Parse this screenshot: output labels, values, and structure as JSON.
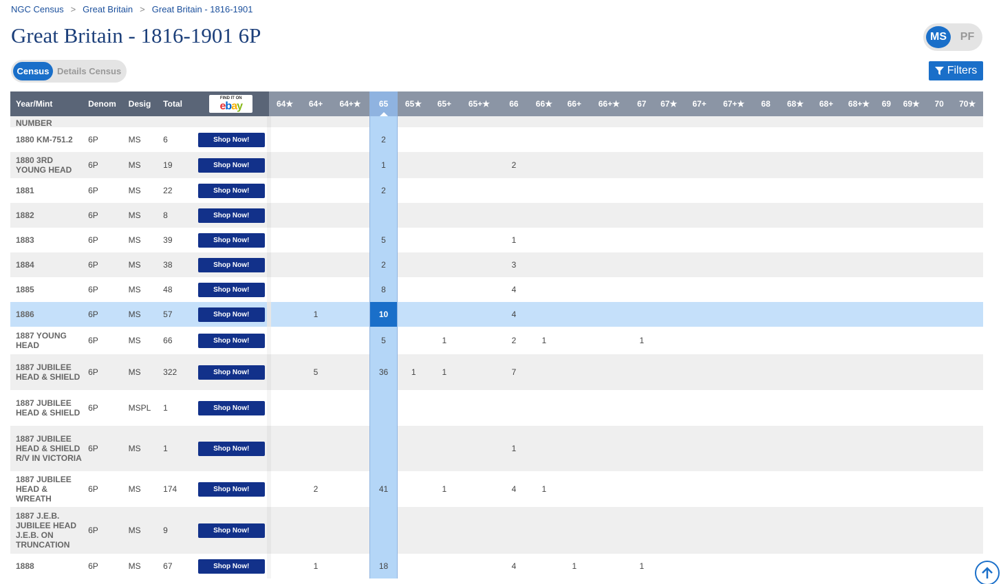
{
  "breadcrumb": [
    "NGC Census",
    "Great Britain",
    "Great Britain - 1816-1901"
  ],
  "title": "Great Britain - 1816-1901 6P",
  "grade_type": {
    "ms": "MS",
    "pf": "PF",
    "active": "MS"
  },
  "view_toggle": {
    "census": "Census",
    "details": "Details Census",
    "active": "Census"
  },
  "filters_label": "Filters",
  "ebay": {
    "find_text": "FIND IT ON",
    "logo": "ebay"
  },
  "columns": {
    "year_mint": "Year/Mint",
    "denom": "Denom",
    "desig": "Desig",
    "total": "Total",
    "grades": [
      "64★",
      "64+",
      "64+★",
      "65",
      "65★",
      "65+",
      "65+★",
      "66",
      "66★",
      "66+",
      "66+★",
      "67",
      "67★",
      "67+",
      "67+★",
      "68",
      "68★",
      "68+",
      "68+★",
      "69",
      "69★",
      "70",
      "70★"
    ]
  },
  "shop_label": "Shop Now!",
  "partial_top_row": {
    "year_mint": "NUMBER"
  },
  "rows": [
    {
      "year_mint": "1880 KM-751.2",
      "denom": "6P",
      "desig": "MS",
      "total": "6",
      "grades": {
        "65": "2"
      }
    },
    {
      "year_mint": "1880 3RD YOUNG HEAD",
      "denom": "6P",
      "desig": "MS",
      "total": "19",
      "grades": {
        "65": "1",
        "66": "2"
      }
    },
    {
      "year_mint": "1881",
      "denom": "6P",
      "desig": "MS",
      "total": "22",
      "grades": {
        "65": "2"
      }
    },
    {
      "year_mint": "1882",
      "denom": "6P",
      "desig": "MS",
      "total": "8",
      "grades": {}
    },
    {
      "year_mint": "1883",
      "denom": "6P",
      "desig": "MS",
      "total": "39",
      "grades": {
        "65": "5",
        "66": "1"
      }
    },
    {
      "year_mint": "1884",
      "denom": "6P",
      "desig": "MS",
      "total": "38",
      "grades": {
        "65": "2",
        "66": "3"
      }
    },
    {
      "year_mint": "1885",
      "denom": "6P",
      "desig": "MS",
      "total": "48",
      "grades": {
        "65": "8",
        "66": "4"
      }
    },
    {
      "year_mint": "1886",
      "denom": "6P",
      "desig": "MS",
      "total": "57",
      "grades": {
        "64+": "1",
        "65": "10",
        "66": "4"
      },
      "highlight": true
    },
    {
      "year_mint": "1887 YOUNG HEAD",
      "denom": "6P",
      "desig": "MS",
      "total": "66",
      "grades": {
        "65": "5",
        "65+": "1",
        "66": "2",
        "66★": "1",
        "67": "1"
      }
    },
    {
      "year_mint": "1887 JUBILEE HEAD & SHIELD",
      "denom": "6P",
      "desig": "MS",
      "total": "322",
      "grades": {
        "64+": "5",
        "65": "36",
        "65★": "1",
        "65+": "1",
        "66": "7"
      }
    },
    {
      "year_mint": "1887 JUBILEE HEAD & SHIELD",
      "denom": "6P",
      "desig": "MSPL",
      "total": "1",
      "grades": {}
    },
    {
      "year_mint": "1887 JUBILEE HEAD & SHIELD R/V IN VICTORIA",
      "denom": "6P",
      "desig": "MS",
      "total": "1",
      "grades": {
        "66": "1"
      }
    },
    {
      "year_mint": "1887 JUBILEE HEAD & WREATH",
      "denom": "6P",
      "desig": "MS",
      "total": "174",
      "grades": {
        "64+": "2",
        "65": "41",
        "65+": "1",
        "66": "4",
        "66★": "1"
      }
    },
    {
      "year_mint": "1887 J.E.B. JUBILEE HEAD J.E.B. ON TRUNCATION",
      "denom": "6P",
      "desig": "MS",
      "total": "9",
      "grades": {}
    },
    {
      "year_mint": "1888",
      "denom": "6P",
      "desig": "MS",
      "total": "67",
      "grades": {
        "64+": "1",
        "65": "18",
        "66": "4",
        "66+": "1",
        "67": "1"
      }
    }
  ],
  "colors": {
    "accent": "#1a6fc9",
    "header": "#8b95a5",
    "highlight_col": "#b4d6f7",
    "shop_btn": "#12318a"
  }
}
